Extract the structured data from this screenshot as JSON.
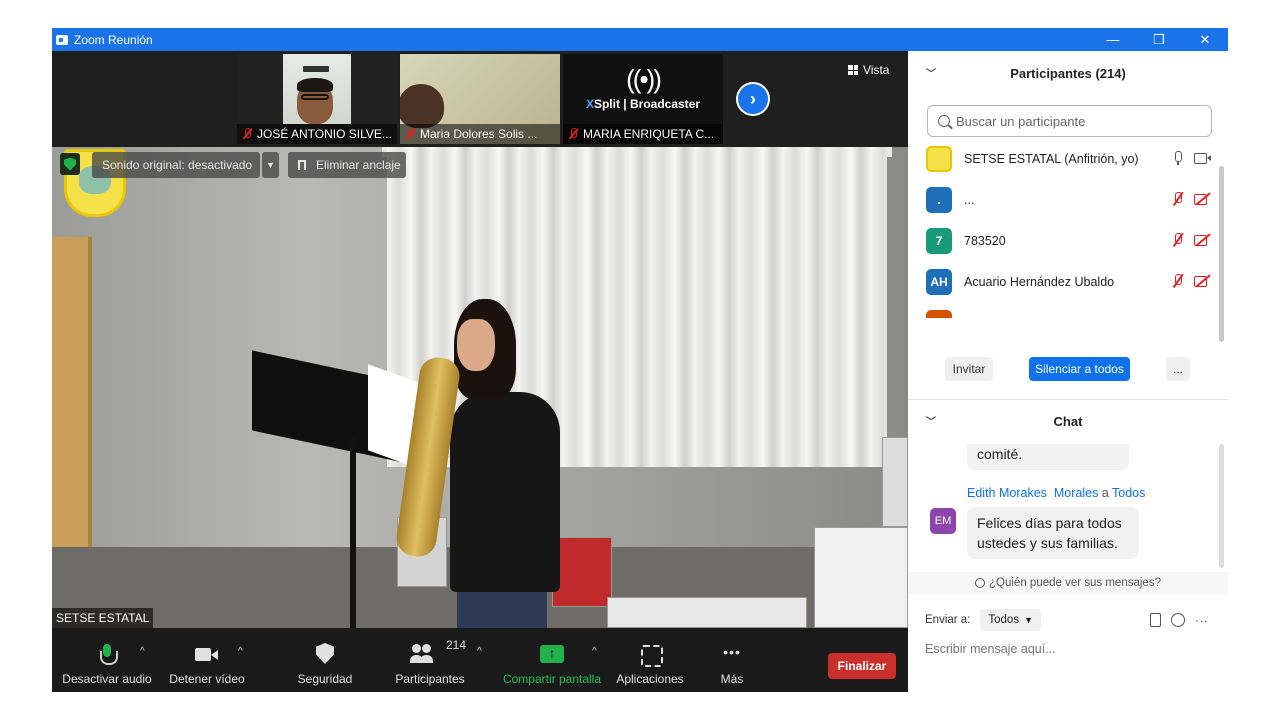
{
  "window": {
    "title": "Zoom Reunión",
    "controls": [
      "—",
      "❐",
      "✕"
    ]
  },
  "stage": {
    "view_label": "Vista",
    "thumbnails": [
      {
        "name": "JOSÉ ANTONIO SILVE..."
      },
      {
        "name": "Maria Dolores Solis ..."
      },
      {
        "name": "MARIA ENRIQUETA C..."
      }
    ],
    "xsplit": {
      "waves": "((•))",
      "brand_x": "X",
      "brand_rest": "Split | Broadcaster"
    },
    "original_sound": "Sonido original: desactivado",
    "unpin": "Eliminar anclaje",
    "speaker_name": "SETSE ESTATAL"
  },
  "toolbar": {
    "audio": "Desactivar audio",
    "video": "Detener vídeo",
    "security": "Seguridad",
    "participants": "Participantes",
    "participants_count": "214",
    "share": "Compartir pantalla",
    "apps": "Aplicaciones",
    "more": "Más",
    "end": "Finalizar"
  },
  "participants_panel": {
    "title": "Participantes (214)",
    "search_placeholder": "Buscar un participante",
    "items": [
      {
        "initials": "",
        "name": "SETSE ESTATAL (Anfitrión, yo)",
        "color": "#f5e24a"
      },
      {
        "initials": ".",
        "name": "...",
        "color": "#1e6fb7"
      },
      {
        "initials": "7",
        "name": "783520",
        "color": "#1a9a7a"
      },
      {
        "initials": "AH",
        "name": "Acuario Hernández Ubaldo",
        "color": "#1e6fb7"
      }
    ],
    "buttons": {
      "invite": "Invitar",
      "mute_all": "Silenciar a todos",
      "more": "..."
    }
  },
  "chat_panel": {
    "title": "Chat",
    "prev_bubble": "comité.",
    "sender_from": "Edith Morakes",
    "sender_to_name": "Morales",
    "sender_a": "a",
    "sender_to": "Todos",
    "avatar": "EM",
    "message": "Felices días para todos ustedes y sus familias.",
    "who_can_see": "¿Quién puede ver sus mensajes?",
    "send_to_label": "Enviar a:",
    "send_to_value": "Todos",
    "input_placeholder": "Escribir mensaje aquí..."
  }
}
